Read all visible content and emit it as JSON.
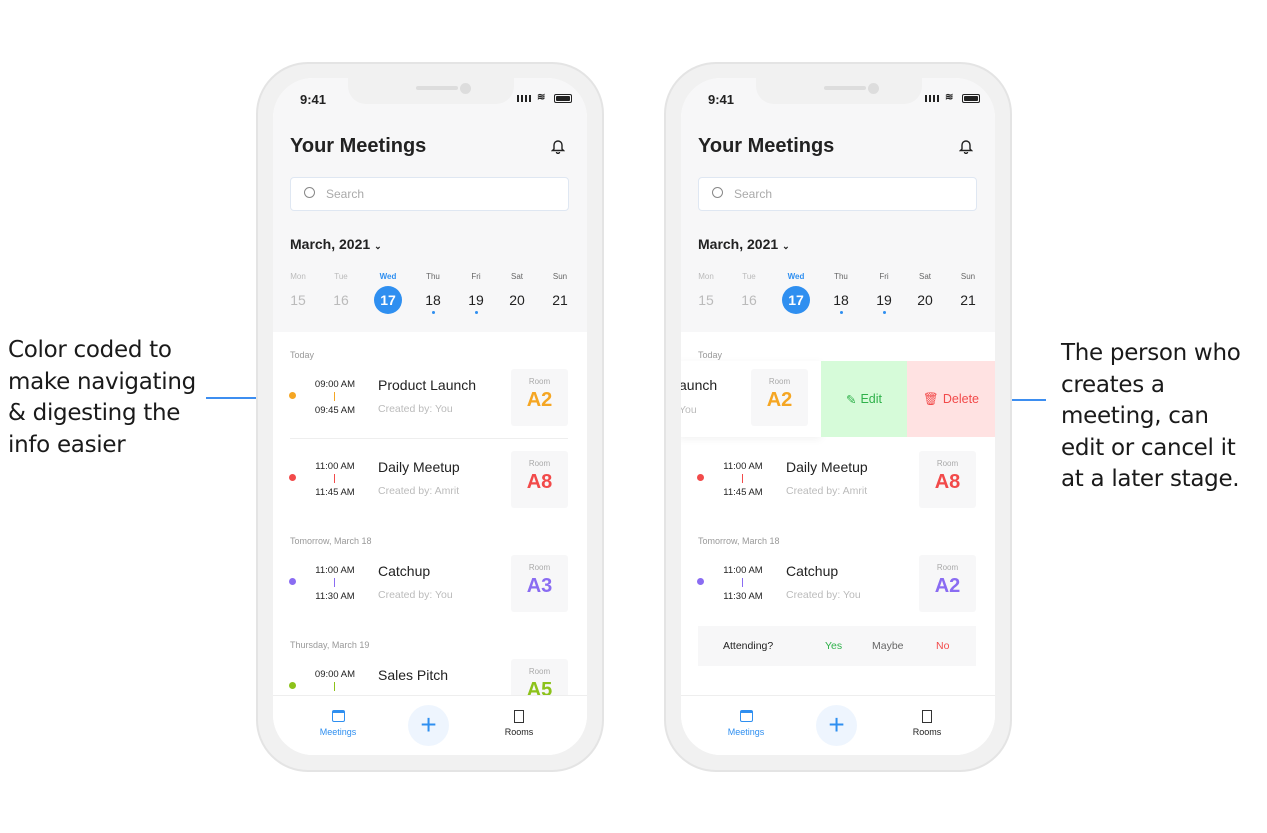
{
  "annotations": {
    "left": [
      "Color coded to",
      "make navigating",
      "& digesting the",
      "info easier"
    ],
    "right": [
      "The person who",
      "creates a",
      "meeting, can",
      "edit or cancel it",
      "at a later stage."
    ]
  },
  "colors": {
    "accent": "#2f8ff0",
    "orange": "#f5a623",
    "red": "#f24a4a",
    "purple": "#8a6cf2",
    "green": "#8cc21a",
    "edit_bg": "#d6fbd9",
    "delete_bg": "#ffe2e2",
    "edit_text": "#2eb14a",
    "delete_text": "#f24a4a"
  },
  "phone": {
    "status_time": "9:41",
    "title": "Your Meetings",
    "search_placeholder": "Search",
    "month": "March, 2021",
    "days": [
      {
        "name": "Mon",
        "num": "15"
      },
      {
        "name": "Tue",
        "num": "16"
      },
      {
        "name": "Wed",
        "num": "17"
      },
      {
        "name": "Thu",
        "num": "18"
      },
      {
        "name": "Fri",
        "num": "19"
      },
      {
        "name": "Sat",
        "num": "20"
      },
      {
        "name": "Sun",
        "num": "21"
      }
    ],
    "nav": {
      "meetings": "Meetings",
      "rooms": "Rooms"
    },
    "room_label": "Room"
  },
  "left": {
    "sections": [
      "Today",
      "Tomorrow, March 18",
      "Thursday, March 19"
    ],
    "meetings": [
      {
        "start": "09:00 AM",
        "end": "09:45 AM",
        "title": "Product Launch",
        "created": "Created by: You",
        "room": "A2",
        "color": "#f5a623"
      },
      {
        "start": "11:00 AM",
        "end": "11:45 AM",
        "title": "Daily Meetup",
        "created": "Created by: Amrit",
        "room": "A8",
        "color": "#f24a4a"
      },
      {
        "start": "11:00 AM",
        "end": "11:30 AM",
        "title": "Catchup",
        "created": "Created by: You",
        "room": "A3",
        "color": "#8a6cf2"
      },
      {
        "start": "09:00 AM",
        "end": "",
        "title": "Sales Pitch",
        "created": "",
        "room": "A5",
        "color": "#8cc21a"
      }
    ]
  },
  "right": {
    "sections": [
      "Today",
      "Tomorrow, March 18"
    ],
    "swiped": {
      "title_partial": "aunch",
      "created_partial": "You",
      "room": "A2",
      "edit": "Edit",
      "delete": "Delete"
    },
    "meetings": [
      {
        "start": "11:00 AM",
        "end": "11:45 AM",
        "title": "Daily Meetup",
        "created": "Created by: Amrit",
        "room": "A8",
        "color": "#f24a4a"
      },
      {
        "start": "11:00 AM",
        "end": "11:30 AM",
        "title": "Catchup",
        "created": "Created by: You",
        "room": "A2",
        "color": "#8a6cf2"
      }
    ],
    "attending": {
      "label": "Attending?",
      "yes": "Yes",
      "maybe": "Maybe",
      "no": "No"
    }
  }
}
